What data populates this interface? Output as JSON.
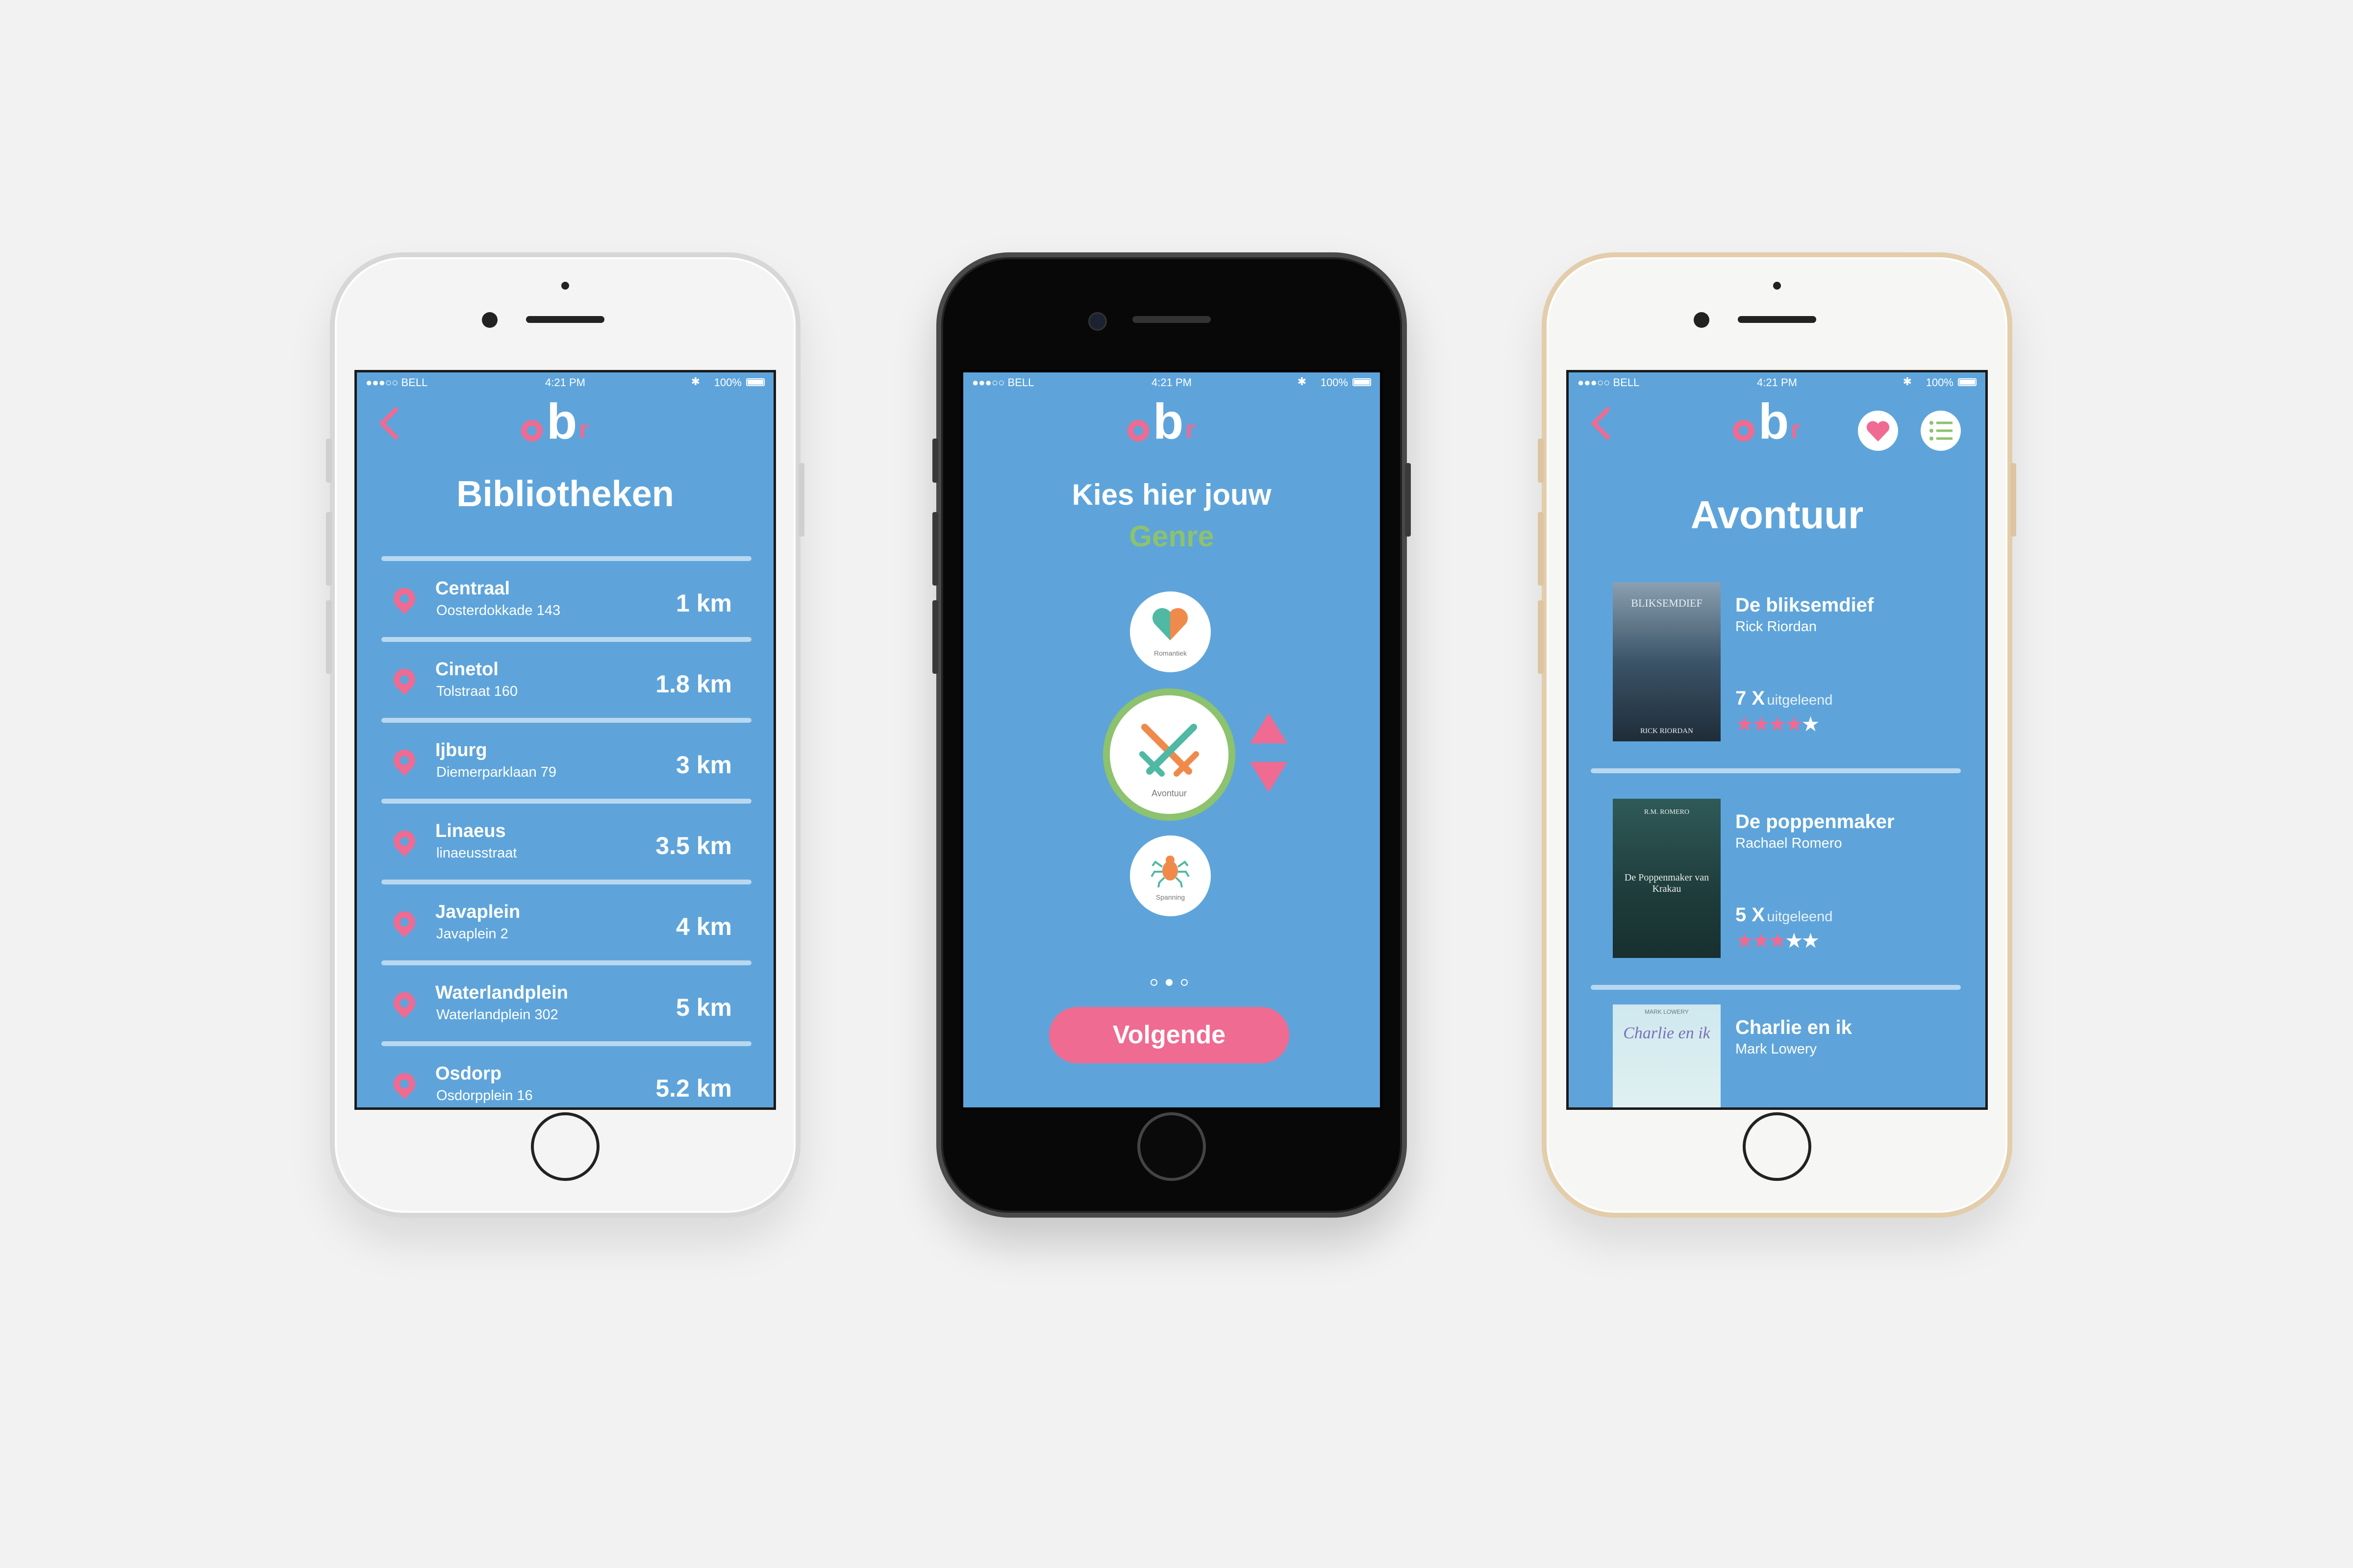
{
  "colors": {
    "background": "#f2f2f2",
    "screen": "#5ea4da",
    "accent_pink": "#ef6b92",
    "accent_green": "#8dc26e",
    "divider": "#b9d8f0",
    "white": "#ffffff"
  },
  "status_bar": {
    "carrier": "●●●○○ BELL",
    "time": "4:21 PM",
    "battery": "100%"
  },
  "logo": {
    "icon": "obr-logo"
  },
  "libraries_screen": {
    "title": "Bibliotheken",
    "items": [
      {
        "name": "Centraal",
        "address": "Oosterdokkade 143",
        "distance": "1 km"
      },
      {
        "name": "Cinetol",
        "address": "Tolstraat 160",
        "distance": "1.8 km"
      },
      {
        "name": "Ijburg",
        "address": "Diemerparklaan 79",
        "distance": "3 km"
      },
      {
        "name": "Linaeus",
        "address": "linaeusstraat",
        "distance": "3.5 km"
      },
      {
        "name": "Javaplein",
        "address": "Javaplein 2",
        "distance": "4 km"
      },
      {
        "name": "Waterlandplein",
        "address": "Waterlandplein 302",
        "distance": "5 km"
      },
      {
        "name": "Osdorp",
        "address": "Osdorpplein 16",
        "distance": "5.2 km"
      }
    ]
  },
  "genre_screen": {
    "title_line1": "Kies hier jouw",
    "title_line2": "Genre",
    "genres": [
      {
        "label": "Romantiek",
        "icon": "heart-icon"
      },
      {
        "label": "Avontuur",
        "icon": "crossed-swords-icon"
      },
      {
        "label": "Spanning",
        "icon": "spider-icon"
      }
    ],
    "page_count": 3,
    "active_page": 2,
    "next_label": "Volgende"
  },
  "books_screen": {
    "title": "Avontuur",
    "books": [
      {
        "title": "De bliksemdief",
        "author": "Rick Riordan",
        "count": "7 X",
        "count_label": "uitgeleend",
        "rating": 4,
        "rating_max": 5,
        "cover_text": "BLIKSEMDIEF",
        "cover_author": "RICK RIORDAN"
      },
      {
        "title": "De poppenmaker",
        "author": "Rachael Romero",
        "count": "5 X",
        "count_label": "uitgeleend",
        "rating": 3,
        "rating_max": 5,
        "cover_text": "De Poppenmaker van Krakau",
        "cover_author": "R.M. ROMERO"
      },
      {
        "title": "Charlie en ik",
        "author": "Mark Lowery",
        "count": "",
        "count_label": "",
        "rating": 0,
        "rating_max": 5,
        "cover_text": "Charlie en ik",
        "cover_author": "MARK LOWERY"
      }
    ]
  }
}
